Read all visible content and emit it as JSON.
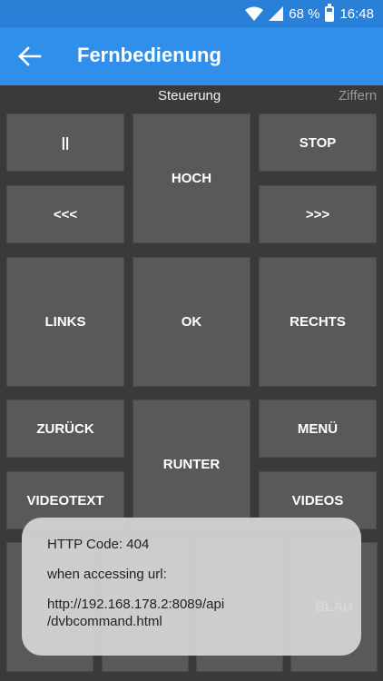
{
  "status_bar": {
    "battery": "68 %",
    "time": "16:48"
  },
  "app_bar": {
    "title": "Fernbedienung",
    "back_icon": "arrow-back-icon"
  },
  "tabs": {
    "active": "Steuerung",
    "next": "Ziffern"
  },
  "buttons": {
    "pause": "||",
    "up": "HOCH",
    "stop": "STOP",
    "rewind": "<<<",
    "forward": ">>>",
    "left": "LINKS",
    "ok": "OK",
    "right": "RECHTS",
    "back": "ZURÜCK",
    "down": "RUNTER",
    "menu": "MENÜ",
    "videotext": "VIDEOTEXT",
    "videos": "VIDEOS",
    "blue": "BLAU"
  },
  "toast": {
    "line1": "HTTP Code: 404",
    "line2": "when accessing url:",
    "line3": "http://192.168.178.2:8089/api",
    "line4": "/dvbcommand.html"
  },
  "colors": {
    "app_bar": "#2f8fea",
    "status_bar": "#2a7fd6",
    "button": "#595959",
    "background": "#3a3a3a"
  }
}
